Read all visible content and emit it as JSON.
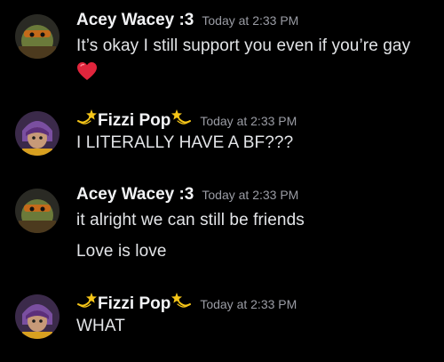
{
  "messages": [
    {
      "author": "Acey Wacey :3",
      "timestamp": "Today at 2:33 PM",
      "lines": [
        "It’s okay I still support you even if you’re gay"
      ],
      "emoji": "heart-emoji"
    },
    {
      "author": "Fizzi Pop",
      "timestamp": "Today at 2:33 PM",
      "lines": [
        "I LITERALLY HAVE A BF???"
      ]
    },
    {
      "author": "Acey Wacey :3",
      "timestamp": "Today at 2:33 PM",
      "lines": [
        "it alright we can still be friends",
        "Love is love"
      ]
    },
    {
      "author": "Fizzi Pop",
      "timestamp": "Today at 2:33 PM",
      "lines": [
        "WHAT"
      ]
    }
  ],
  "colors": {
    "background": "#000000",
    "username": "#f2f3f5",
    "timestamp": "#9a9ca4",
    "message_text": "#e3e5e8",
    "heart": "#e0253c",
    "dizzy_star": "#f5c518"
  }
}
